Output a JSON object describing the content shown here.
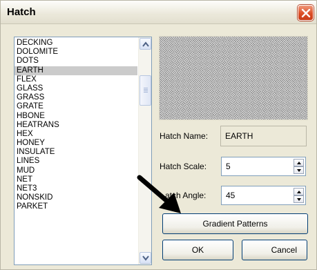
{
  "window": {
    "title": "Hatch"
  },
  "patterns": [
    "DECKING",
    "DOLOMITE",
    "DOTS",
    "EARTH",
    "FLEX",
    "GLASS",
    "GRASS",
    "GRATE",
    "HBONE",
    "HEATRANS",
    "HEX",
    "HONEY",
    "INSULATE",
    "LINES",
    "MUD",
    "NET",
    "NET3",
    "NONSKID",
    "PARKET"
  ],
  "selected_pattern": "EARTH",
  "hatch_name": {
    "label": "Hatch Name:",
    "value": "EARTH"
  },
  "hatch_scale": {
    "label": "Hatch Scale:",
    "value": "5"
  },
  "hatch_angle": {
    "label": "atch Angle:",
    "value": "45"
  },
  "buttons": {
    "gradient": "Gradient Patterns",
    "ok": "OK",
    "cancel": "Cancel"
  },
  "icons": {
    "close": "close-x-icon",
    "scroll_up": "arrow-up-icon",
    "scroll_down": "arrow-down-icon",
    "spin_up": "spin-up-icon",
    "spin_down": "spin-down-icon",
    "pointer": "pointer-arrow-icon"
  },
  "colors": {
    "selected_row": "#cbcbcb",
    "close_button": "#dc4f27",
    "dialog_bg": "#ece9d8"
  }
}
